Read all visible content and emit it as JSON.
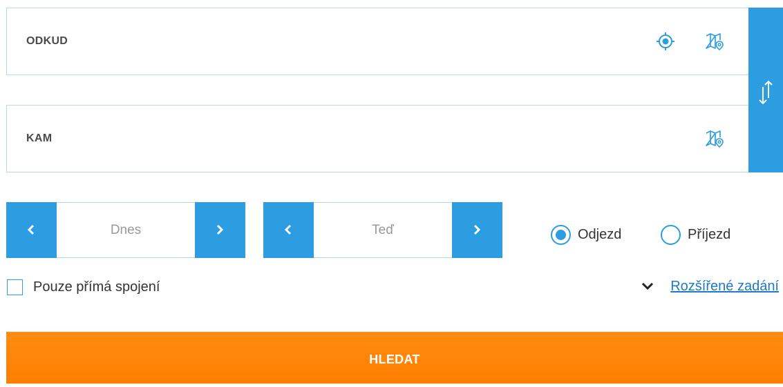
{
  "from_field": {
    "label": "ODKUD",
    "icons": [
      "locate-icon",
      "map-pin-icon"
    ]
  },
  "to_field": {
    "label": "KAM",
    "icons": [
      "map-pin-icon"
    ]
  },
  "swap": {
    "icon": "swap-arrows-icon"
  },
  "date": {
    "value": "Dnes",
    "prev_icon": "chevron-left-icon",
    "next_icon": "chevron-right-icon"
  },
  "time": {
    "value": "Teď",
    "prev_icon": "chevron-left-icon",
    "next_icon": "chevron-right-icon"
  },
  "mode": {
    "departure_label": "Odjezd",
    "arrival_label": "Příjezd",
    "selected": "Odjezd"
  },
  "direct_only": {
    "label": "Pouze přímá spojení",
    "checked": false
  },
  "advanced": {
    "label": "Rozšířené zadání",
    "icon": "chevron-down-icon"
  },
  "search": {
    "label": "HLEDAT"
  },
  "colors": {
    "primary_blue": "#2b9de0",
    "field_border": "#b7d9ef",
    "link_blue": "#1d79c7",
    "search_orange": "#ff8400"
  }
}
